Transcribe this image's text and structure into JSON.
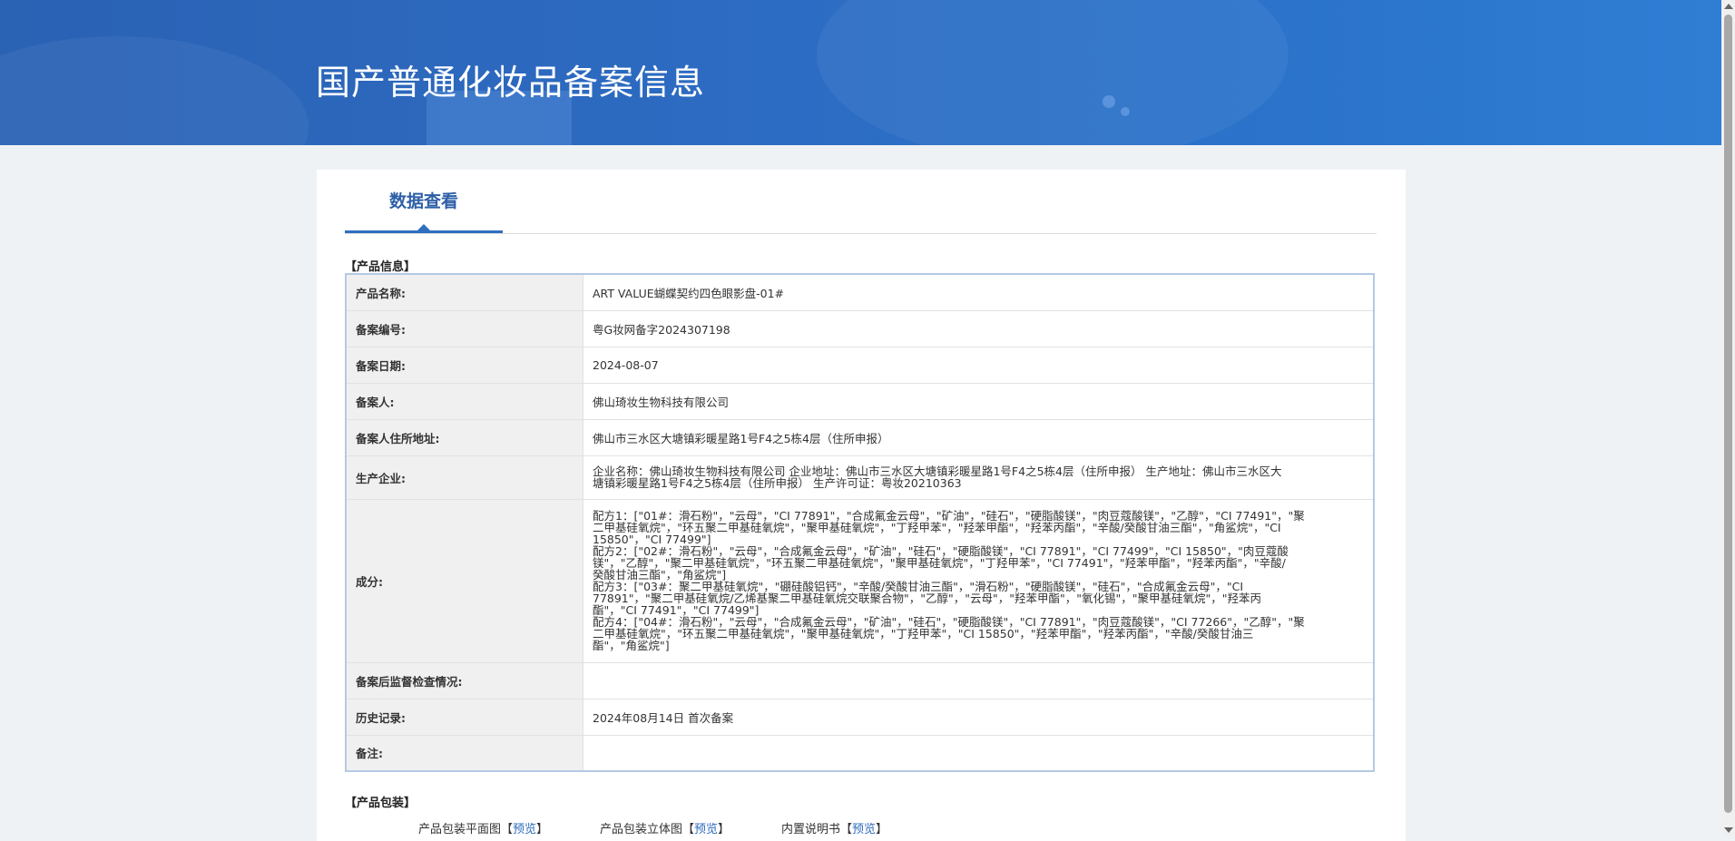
{
  "page": {
    "title": "国产普通化妆品备案信息"
  },
  "tabs": [
    {
      "label": "数据查看"
    }
  ],
  "product_section": {
    "title": "【产品信息】",
    "rows": [
      {
        "label": "产品名称:",
        "value": "ART VALUE蝴蝶契约四色眼影盘-01#"
      },
      {
        "label": "备案编号:",
        "value": "粤G妆网备字2024307198"
      },
      {
        "label": "备案日期:",
        "value": "2024-08-07"
      },
      {
        "label": "备案人:",
        "value": "佛山琦妆生物科技有限公司"
      },
      {
        "label": "备案人住所地址:",
        "value": "佛山市三水区大塘镇彩暖星路1号F4之5栋4层（住所申报）"
      },
      {
        "label": "生产企业:",
        "value": "企业名称：佛山琦妆生物科技有限公司 企业地址：佛山市三水区大塘镇彩暖星路1号F4之5栋4层（住所申报） 生产地址：佛山市三水区大\n塘镇彩暖星路1号F4之5栋4层（住所申报） 生产许可证：粤妆20210363"
      },
      {
        "label": "成分:",
        "value": "配方1：[\"01#：滑石粉\"，\"云母\"，\"CI 77891\"，\"合成氟金云母\"，\"矿油\"，\"硅石\"，\"硬脂酸镁\"，\"肉豆蔻酸镁\"，\"乙醇\"，\"CI 77491\"，\"聚\n二甲基硅氧烷\"，\"环五聚二甲基硅氧烷\"，\"聚甲基硅氧烷\"，\"丁羟甲苯\"，\"羟苯甲酯\"，\"羟苯丙酯\"，\"辛酸/癸酸甘油三酯\"，\"角鲨烷\"，\"CI\n15850\"，\"CI 77499\"]\n配方2：[\"02#：滑石粉\"，\"云母\"，\"合成氟金云母\"，\"矿油\"，\"硅石\"，\"硬脂酸镁\"，\"CI 77891\"，\"CI 77499\"，\"CI 15850\"，\"肉豆蔻酸\n镁\"，\"乙醇\"，\"聚二甲基硅氧烷\"，\"环五聚二甲基硅氧烷\"，\"聚甲基硅氧烷\"，\"丁羟甲苯\"，\"CI 77491\"，\"羟苯甲酯\"，\"羟苯丙酯\"，\"辛酸/\n癸酸甘油三酯\"，\"角鲨烷\"]\n配方3：[\"03#：聚二甲基硅氧烷\"，\"硼硅酸铝钙\"，\"辛酸/癸酸甘油三酯\"，\"滑石粉\"，\"硬脂酸镁\"，\"硅石\"，\"合成氟金云母\"，\"CI\n77891\"，\"聚二甲基硅氧烷/乙烯基聚二甲基硅氧烷交联聚合物\"，\"乙醇\"，\"云母\"，\"羟苯甲酯\"，\"氧化锡\"，\"聚甲基硅氧烷\"，\"羟苯丙\n酯\"，\"CI 77491\"，\"CI 77499\"]\n配方4：[\"04#：滑石粉\"，\"云母\"，\"合成氟金云母\"，\"矿油\"，\"硅石\"，\"硬脂酸镁\"，\"CI 77891\"，\"肉豆蔻酸镁\"，\"CI 77266\"，\"乙醇\"，\"聚\n二甲基硅氧烷\"，\"环五聚二甲基硅氧烷\"，\"聚甲基硅氧烷\"，\"丁羟甲苯\"，\"CI 15850\"，\"羟苯甲酯\"，\"羟苯丙酯\"，\"辛酸/癸酸甘油三\n酯\"，\"角鲨烷\"]"
      },
      {
        "label": "备案后监督检查情况:",
        "value": ""
      },
      {
        "label": "历史记录:",
        "value": "2024年08月14日 首次备案"
      },
      {
        "label": "备注:",
        "value": ""
      }
    ]
  },
  "package_section": {
    "title": "【产品包装】",
    "items": [
      {
        "label": "产品包装平面图",
        "bracket_open": "【",
        "link": "预览",
        "bracket_close": "】"
      },
      {
        "label": "产品包装立体图",
        "bracket_open": "【",
        "link": "预览",
        "bracket_close": "】"
      },
      {
        "label": "内置说明书",
        "bracket_open": "【",
        "link": "预览",
        "bracket_close": "】"
      }
    ]
  }
}
